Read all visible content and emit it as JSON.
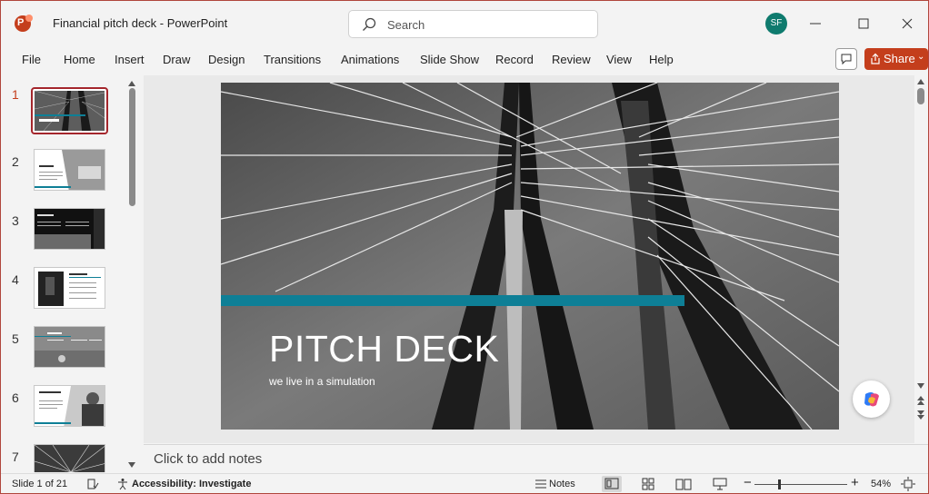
{
  "window": {
    "title": "Financial pitch deck  -  PowerPoint",
    "search_placeholder": "Search",
    "user_initials": "SF"
  },
  "ribbon": {
    "tabs": [
      "File",
      "Home",
      "Insert",
      "Draw",
      "Design",
      "Transitions",
      "Animations",
      "Slide Show",
      "Record",
      "Review",
      "View",
      "Help"
    ],
    "share_label": "Share"
  },
  "thumbnails": {
    "numbers": [
      "1",
      "2",
      "3",
      "4",
      "5",
      "6",
      "7"
    ],
    "selected": 1
  },
  "slide": {
    "title": "PITCH DECK",
    "subtitle": "we live in a simulation"
  },
  "notes": {
    "placeholder": "Click to add notes"
  },
  "status": {
    "slide_position": "Slide 1 of 21",
    "accessibility": "Accessibility: Investigate",
    "notes_label": "Notes",
    "zoom": "54%"
  },
  "colors": {
    "accent": "#c43e1c",
    "teal": "#0e7f96",
    "selected_border": "#a4262c"
  }
}
